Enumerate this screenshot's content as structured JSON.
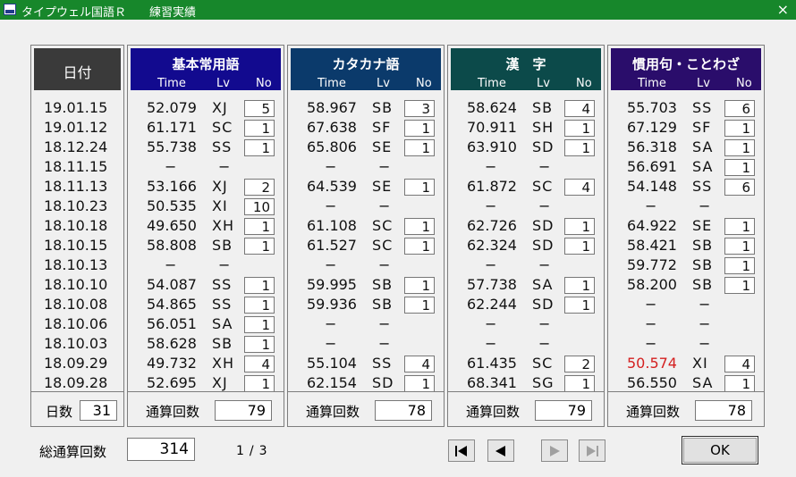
{
  "window": {
    "title": "タイプウェル国語Ｒ　　練習実績",
    "close": "×"
  },
  "date_panel": {
    "title": "日付",
    "dates": [
      "19.01.15",
      "19.01.12",
      "18.12.24",
      "18.11.15",
      "18.11.13",
      "18.10.23",
      "18.10.18",
      "18.10.15",
      "18.10.13",
      "18.10.10",
      "18.10.08",
      "18.10.06",
      "18.10.03",
      "18.09.29",
      "18.09.28"
    ],
    "days_label": "日数",
    "days_value": "31"
  },
  "columns": {
    "time": "Time",
    "lv": "Lv",
    "no": "No"
  },
  "panels": [
    {
      "title": "基本常用語",
      "header_color": "#120a8f",
      "rows": [
        {
          "time": "52.079",
          "lv": "XJ",
          "no": "5"
        },
        {
          "time": "61.171",
          "lv": "SC",
          "no": "1"
        },
        {
          "time": "55.738",
          "lv": "SS",
          "no": "1"
        },
        {
          "time": "−",
          "lv": "−",
          "no": ""
        },
        {
          "time": "53.166",
          "lv": "XJ",
          "no": "2"
        },
        {
          "time": "50.535",
          "lv": "XI",
          "no": "10"
        },
        {
          "time": "49.650",
          "lv": "XH",
          "no": "1"
        },
        {
          "time": "58.808",
          "lv": "SB",
          "no": "1"
        },
        {
          "time": "−",
          "lv": "−",
          "no": ""
        },
        {
          "time": "54.087",
          "lv": "SS",
          "no": "1"
        },
        {
          "time": "54.865",
          "lv": "SS",
          "no": "1"
        },
        {
          "time": "56.051",
          "lv": "SA",
          "no": "1"
        },
        {
          "time": "58.628",
          "lv": "SB",
          "no": "1"
        },
        {
          "time": "49.732",
          "lv": "XH",
          "no": "4"
        },
        {
          "time": "52.695",
          "lv": "XJ",
          "no": "1"
        }
      ],
      "total_label": "通算回数",
      "total_value": "79"
    },
    {
      "title": "カタカナ語",
      "header_color": "#0b3a6b",
      "rows": [
        {
          "time": "58.967",
          "lv": "SB",
          "no": "3"
        },
        {
          "time": "67.638",
          "lv": "SF",
          "no": "1"
        },
        {
          "time": "65.806",
          "lv": "SE",
          "no": "1"
        },
        {
          "time": "−",
          "lv": "−",
          "no": ""
        },
        {
          "time": "64.539",
          "lv": "SE",
          "no": "1"
        },
        {
          "time": "−",
          "lv": "−",
          "no": ""
        },
        {
          "time": "61.108",
          "lv": "SC",
          "no": "1"
        },
        {
          "time": "61.527",
          "lv": "SC",
          "no": "1"
        },
        {
          "time": "−",
          "lv": "−",
          "no": ""
        },
        {
          "time": "59.995",
          "lv": "SB",
          "no": "1"
        },
        {
          "time": "59.936",
          "lv": "SB",
          "no": "1"
        },
        {
          "time": "−",
          "lv": "−",
          "no": ""
        },
        {
          "time": "−",
          "lv": "−",
          "no": ""
        },
        {
          "time": "55.104",
          "lv": "SS",
          "no": "4"
        },
        {
          "time": "62.154",
          "lv": "SD",
          "no": "1"
        }
      ],
      "total_label": "通算回数",
      "total_value": "78"
    },
    {
      "title": "漢　字",
      "header_color": "#0c4a4a",
      "rows": [
        {
          "time": "58.624",
          "lv": "SB",
          "no": "4"
        },
        {
          "time": "70.911",
          "lv": "SH",
          "no": "1"
        },
        {
          "time": "63.910",
          "lv": "SD",
          "no": "1"
        },
        {
          "time": "−",
          "lv": "−",
          "no": ""
        },
        {
          "time": "61.872",
          "lv": "SC",
          "no": "4"
        },
        {
          "time": "−",
          "lv": "−",
          "no": ""
        },
        {
          "time": "62.726",
          "lv": "SD",
          "no": "1"
        },
        {
          "time": "62.324",
          "lv": "SD",
          "no": "1"
        },
        {
          "time": "−",
          "lv": "−",
          "no": ""
        },
        {
          "time": "57.738",
          "lv": "SA",
          "no": "1"
        },
        {
          "time": "62.244",
          "lv": "SD",
          "no": "1"
        },
        {
          "time": "−",
          "lv": "−",
          "no": ""
        },
        {
          "time": "−",
          "lv": "−",
          "no": ""
        },
        {
          "time": "61.435",
          "lv": "SC",
          "no": "2"
        },
        {
          "time": "68.341",
          "lv": "SG",
          "no": "1"
        }
      ],
      "total_label": "通算回数",
      "total_value": "79"
    },
    {
      "title": "慣用句・ことわざ",
      "header_color": "#2a0d6b",
      "rows": [
        {
          "time": "55.703",
          "lv": "SS",
          "no": "6"
        },
        {
          "time": "67.129",
          "lv": "SF",
          "no": "1"
        },
        {
          "time": "56.318",
          "lv": "SA",
          "no": "1"
        },
        {
          "time": "56.691",
          "lv": "SA",
          "no": "1"
        },
        {
          "time": "54.148",
          "lv": "SS",
          "no": "6"
        },
        {
          "time": "−",
          "lv": "−",
          "no": ""
        },
        {
          "time": "64.922",
          "lv": "SE",
          "no": "1"
        },
        {
          "time": "58.421",
          "lv": "SB",
          "no": "1"
        },
        {
          "time": "59.772",
          "lv": "SB",
          "no": "1"
        },
        {
          "time": "58.200",
          "lv": "SB",
          "no": "1"
        },
        {
          "time": "−",
          "lv": "−",
          "no": ""
        },
        {
          "time": "−",
          "lv": "−",
          "no": ""
        },
        {
          "time": "−",
          "lv": "−",
          "no": ""
        },
        {
          "time": "50.574",
          "lv": "XI",
          "no": "4",
          "highlight": "#d42020"
        },
        {
          "time": "56.550",
          "lv": "SA",
          "no": "1"
        }
      ],
      "total_label": "通算回数",
      "total_value": "78"
    }
  ],
  "footer": {
    "grand_total_label": "総通算回数",
    "grand_total_value": "314",
    "page_current": "1",
    "page_sep": "/",
    "page_total": "3",
    "nav_first_icon": "first-page-icon",
    "nav_prev_icon": "prev-page-icon",
    "nav_next_icon": "next-page-icon",
    "nav_last_icon": "last-page-icon",
    "ok_label": "OK"
  }
}
